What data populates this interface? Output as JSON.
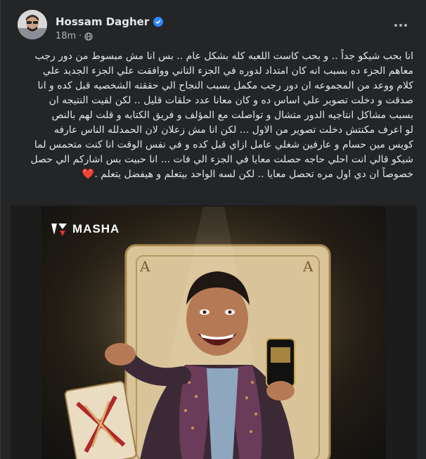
{
  "post": {
    "author": "Hossam Dagher",
    "time": "18m",
    "verified": true,
    "lines": [
      "انا بحب شيكو جداً .. و بحب كاست اللعبه كله  بشكل عام .. بس انا مش مبسوط من دور رجب",
      "معاهم الجزء ده بسبب انه كان امتداد لدوره في الجزء التاني ووافقت علي الجزء الجديد علي",
      "كلام ووعد من المجموعه ان دور رجب مكمل بسبب النجاح الي حققته الشخصيه قبل كده و انا",
      "صدقت و دخلت تصوير علي اساس ده و كان معانا عدد حلقات قليل .. لكن لقيت النتيجه ان",
      "بسبب مشاكل انتاجيه الدور  متشال و تواصلت مع المؤلف و فريق الكتابه و قلت لهم بالنص",
      "لو اعرف مكنتش دخلت تصوير من الاول ...  لكن انا مش زعلان لان الحمدلله الناس عارفه",
      "كويس مين حسام و عارفين شغلي عامل ازاي قبل كده و في نفس الوقت انا كنت متحمس لما",
      "شيكو قالي انت احلي حاجه حصلت معايا في الجزء الي فات ... انا حبيت بس اشاركم الي حصل",
      "خصوصاً ان دي اول مره تحصل معايا .. لكن لسه الواحد بيتعلم و هيفضل يتعلم ."
    ],
    "end_emoji": "❤️"
  },
  "media": {
    "logo_text": "MASHA",
    "card_rank": "A"
  },
  "colors": {
    "background": "#242526",
    "text": "#e4e6eb",
    "secondary": "#b0b3b8",
    "verified": "#2d88ff"
  }
}
